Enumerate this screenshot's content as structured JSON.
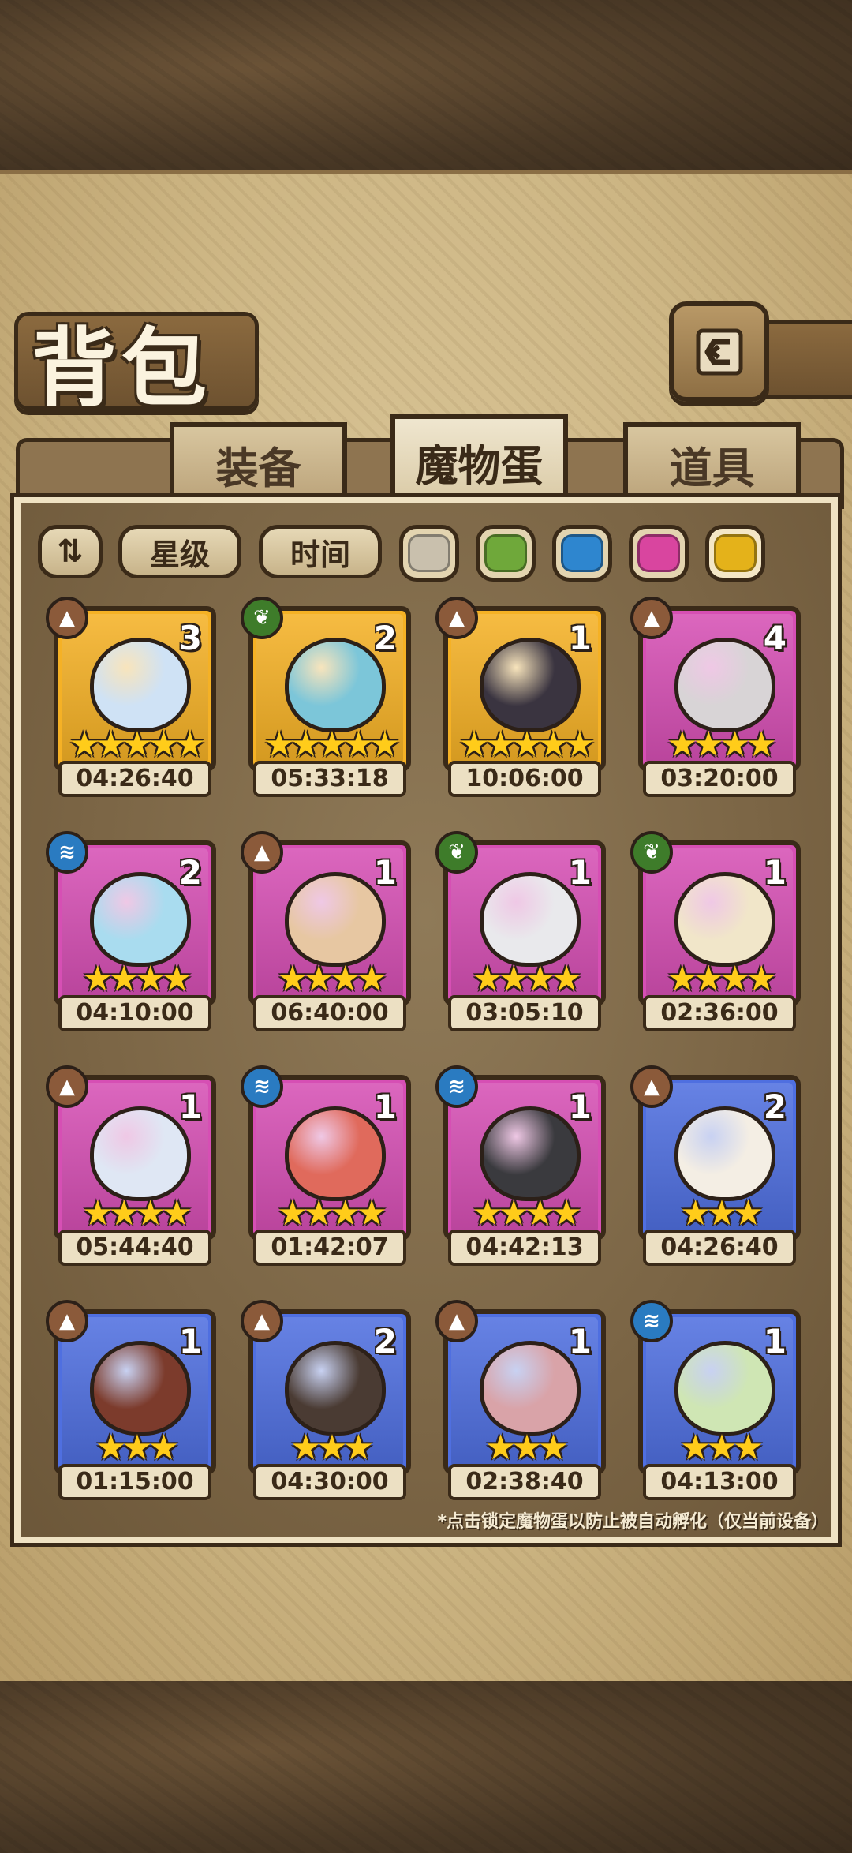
{
  "header": {
    "title": "背包",
    "back_icon": "back-arrow-icon"
  },
  "tabs": [
    {
      "label": "装备",
      "active": false
    },
    {
      "label": "魔物蛋",
      "active": true
    },
    {
      "label": "道具",
      "active": false
    }
  ],
  "filters": {
    "order_icon": "sort-order-icon",
    "sort_star_label": "星级",
    "sort_time_label": "时间",
    "rarity_swatches": [
      "#c9c0ad",
      "#6fa83a",
      "#2e86cf",
      "#d9459f",
      "#e4b21a"
    ],
    "selected_swatch": 4
  },
  "eggs": [
    {
      "element": "earth",
      "count": "3",
      "stars": "★★★★★",
      "rarity": "#f5b125",
      "body": "#cfe2f5",
      "timer": "04:26:40"
    },
    {
      "element": "leaf",
      "count": "2",
      "stars": "★★★★★",
      "rarity": "#f5b125",
      "body": "#7cc6d9",
      "timer": "05:33:18"
    },
    {
      "element": "earth",
      "count": "1",
      "stars": "★★★★★",
      "rarity": "#f5b125",
      "body": "#3a3440",
      "timer": "10:06:00"
    },
    {
      "element": "earth",
      "count": "4",
      "stars": "★★★★",
      "rarity": "#d64fb4",
      "body": "#d8d4d6",
      "timer": "03:20:00"
    },
    {
      "element": "water",
      "count": "2",
      "stars": "★★★★",
      "rarity": "#d64fb4",
      "body": "#a9dcef",
      "timer": "04:10:00"
    },
    {
      "element": "earth",
      "count": "1",
      "stars": "★★★★",
      "rarity": "#d64fb4",
      "body": "#e7c7a2",
      "timer": "06:40:00"
    },
    {
      "element": "leaf",
      "count": "1",
      "stars": "★★★★",
      "rarity": "#d64fb4",
      "body": "#e9e9ec",
      "timer": "03:05:10"
    },
    {
      "element": "leaf",
      "count": "1",
      "stars": "★★★★",
      "rarity": "#d64fb4",
      "body": "#f1e6c9",
      "timer": "02:36:00"
    },
    {
      "element": "earth",
      "count": "1",
      "stars": "★★★★",
      "rarity": "#d64fb4",
      "body": "#dfe7f4",
      "timer": "05:44:40"
    },
    {
      "element": "water",
      "count": "1",
      "stars": "★★★★",
      "rarity": "#d64fb4",
      "body": "#e06a5c",
      "timer": "01:42:07"
    },
    {
      "element": "water",
      "count": "1",
      "stars": "★★★★",
      "rarity": "#d64fb4",
      "body": "#3a3a3e",
      "timer": "04:42:13"
    },
    {
      "element": "earth",
      "count": "2",
      "stars": "★★★",
      "rarity": "#4f6fe0",
      "body": "#f4eee4",
      "timer": "04:26:40"
    },
    {
      "element": "earth",
      "count": "1",
      "stars": "★★★",
      "rarity": "#4f6fe0",
      "body": "#7c3b2c",
      "timer": "01:15:00"
    },
    {
      "element": "earth",
      "count": "2",
      "stars": "★★★",
      "rarity": "#4f6fe0",
      "body": "#4a3b33",
      "timer": "04:30:00"
    },
    {
      "element": "earth",
      "count": "1",
      "stars": "★★★",
      "rarity": "#4f6fe0",
      "body": "#d9a3a8",
      "timer": "02:38:40"
    },
    {
      "element": "water",
      "count": "1",
      "stars": "★★★",
      "rarity": "#4f6fe0",
      "body": "#cfe6b4",
      "timer": "04:13:00"
    }
  ],
  "footnote": "*点击锁定魔物蛋以防止被自动孵化（仅当前设备）"
}
